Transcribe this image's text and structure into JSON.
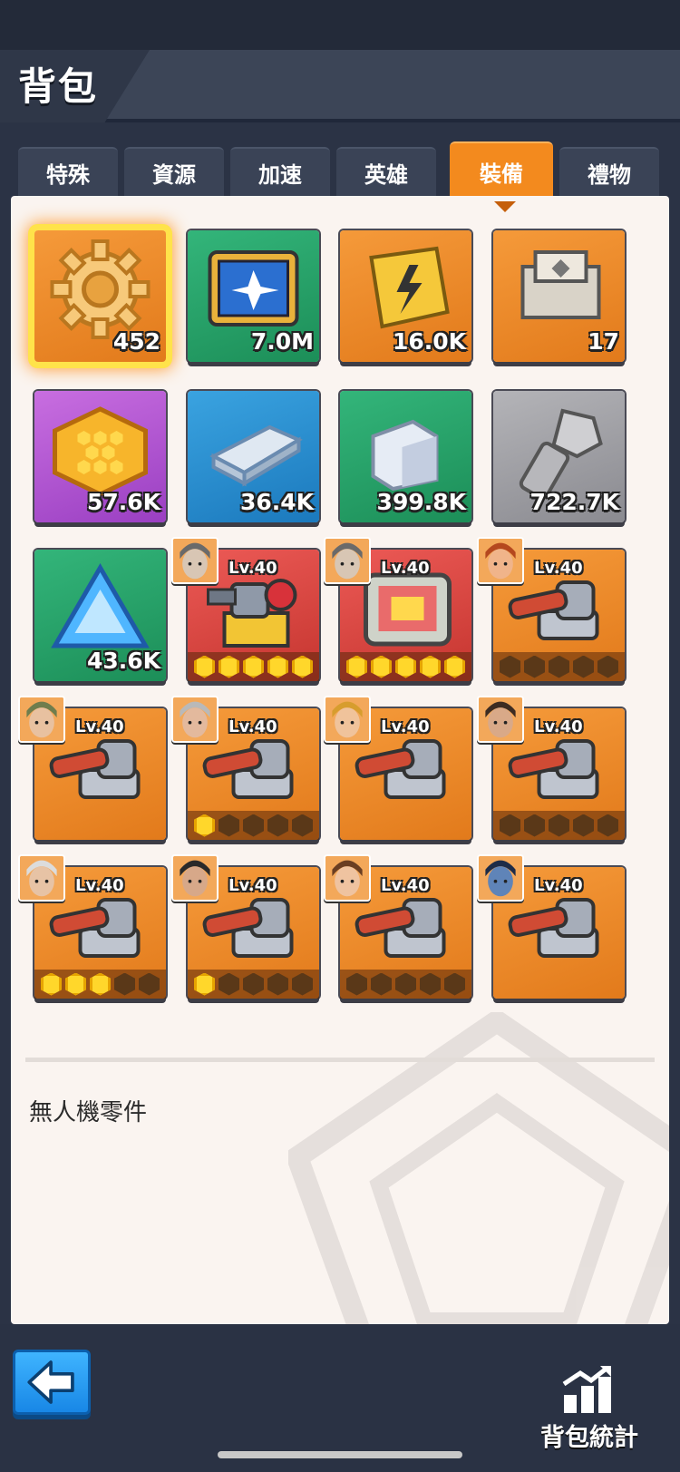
{
  "header": {
    "title": "背包"
  },
  "tabs": [
    {
      "label": "特殊",
      "active": false
    },
    {
      "label": "資源",
      "active": false
    },
    {
      "label": "加速",
      "active": false
    },
    {
      "label": "英雄",
      "active": false
    },
    {
      "label": "裝備",
      "active": true
    },
    {
      "label": "禮物",
      "active": false
    }
  ],
  "items": [
    {
      "icon": "gear-icon",
      "bg": "orange",
      "qty": "452",
      "selected": true
    },
    {
      "icon": "drone-chip-icon",
      "bg": "green",
      "qty": "7.0M"
    },
    {
      "icon": "power-card-icon",
      "bg": "orange",
      "qty": "16.0K"
    },
    {
      "icon": "device-box-icon",
      "bg": "orange",
      "qty": "17"
    },
    {
      "icon": "honeycomb-alloy-icon",
      "bg": "purple",
      "qty": "57.6K"
    },
    {
      "icon": "steel-bar-icon",
      "bg": "blue",
      "qty": "36.4K"
    },
    {
      "icon": "ore-block-icon",
      "bg": "green",
      "qty": "399.8K"
    },
    {
      "icon": "bolt-screw-icon",
      "bg": "gray",
      "qty": "722.7K"
    },
    {
      "icon": "crystal-icon",
      "bg": "green",
      "qty": "43.6K"
    },
    {
      "icon": "turret-robot-icon",
      "bg": "red",
      "level": "Lv.40",
      "portrait": "hero-portrait-goggles",
      "stars": 5
    },
    {
      "icon": "tablet-device-icon",
      "bg": "red",
      "level": "Lv.40",
      "portrait": "hero-portrait-goggles",
      "stars": 5
    },
    {
      "icon": "cannon-icon",
      "bg": "orange",
      "level": "Lv.40",
      "portrait": "hero-portrait-redhair",
      "stars": 0
    },
    {
      "icon": "cannon-icon",
      "bg": "orange",
      "level": "Lv.40",
      "portrait": "hero-portrait-camo",
      "stars": null
    },
    {
      "icon": "cannon-icon",
      "bg": "orange",
      "level": "Lv.40",
      "portrait": "hero-portrait-oldman",
      "stars": 1
    },
    {
      "icon": "cannon-icon",
      "bg": "orange",
      "level": "Lv.40",
      "portrait": "hero-portrait-blond",
      "stars": null
    },
    {
      "icon": "cannon-icon",
      "bg": "orange",
      "level": "Lv.40",
      "portrait": "hero-portrait-bearded",
      "stars": 0
    },
    {
      "icon": "cannon-icon",
      "bg": "orange",
      "level": "Lv.40",
      "portrait": "hero-portrait-scientist",
      "stars": 3
    },
    {
      "icon": "cannon-icon",
      "bg": "orange",
      "level": "Lv.40",
      "portrait": "hero-portrait-soldier",
      "stars": 1
    },
    {
      "icon": "cannon-icon",
      "bg": "orange",
      "level": "Lv.40",
      "portrait": "hero-portrait-brownhair",
      "stars": 0
    },
    {
      "icon": "cannon-icon",
      "bg": "orange",
      "level": "Lv.40",
      "portrait": "hero-portrait-masked",
      "stars": null
    }
  ],
  "detail": {
    "description": "無人機零件"
  },
  "footer": {
    "back_icon": "back-arrow-icon",
    "stats_icon": "bar-chart-icon",
    "stats_label": "背包統計"
  },
  "colors": {
    "accent": "#f38a1e",
    "selected_border": "#ffe34a",
    "star_on": "#ffd72b",
    "back_button": "#1887e6"
  }
}
